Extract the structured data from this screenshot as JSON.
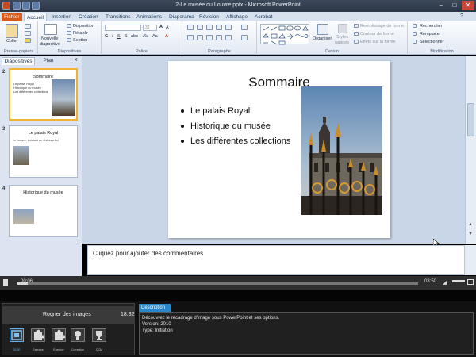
{
  "window": {
    "title": "2-Le musée du Louvre.pptx - Microsoft PowerPoint"
  },
  "ribbon": {
    "tabs": [
      "Fichier",
      "Accueil",
      "Insertion",
      "Création",
      "Transitions",
      "Animations",
      "Diaporama",
      "Révision",
      "Affichage",
      "Acrobat"
    ],
    "clipboard": {
      "paste": "Coller",
      "label": "Presse-papiers"
    },
    "slides": {
      "new_slide_1": "Nouvelle",
      "new_slide_2": "diapositive",
      "layout": "Disposition",
      "reset": "Rétablir",
      "section": "Section",
      "label": "Diapositives"
    },
    "font": {
      "label": "Police",
      "size": "32"
    },
    "paragraph": {
      "label": "Paragraphe"
    },
    "drawing": {
      "arrange": "Organiser",
      "quick_styles_1": "Styles",
      "quick_styles_2": "rapides",
      "fill": "Remplissage de forme",
      "outline": "Contour de forme",
      "effects": "Effets sur la forme",
      "label": "Dessin"
    },
    "editing": {
      "find": "Rechercher",
      "replace": "Remplacer",
      "select": "Sélectionner",
      "label": "Modification"
    }
  },
  "left_pane": {
    "tabs": [
      "Diapositives",
      "Plan"
    ],
    "close": "x",
    "slides": [
      {
        "number": "2",
        "title": "Sommaire",
        "bullets": [
          "Le palais Royal",
          "Historique du musée",
          "Les différentes collections"
        ]
      },
      {
        "number": "3",
        "title": "Le palais Royal",
        "bullets": [
          "Le Louvre, existant un château fort"
        ]
      },
      {
        "number": "4",
        "title": "Historique du musée",
        "bullets": []
      }
    ]
  },
  "slide": {
    "title": "Sommaire",
    "bullets": [
      "Le palais Royal",
      "Historique du musée",
      "Les différentes collections"
    ]
  },
  "notes": {
    "placeholder": "Cliquez pour ajouter des commentaires"
  },
  "player": {
    "elapsed": "00:06",
    "duration": "03:50",
    "progress_fraction": 0.026
  },
  "chapter": {
    "title": "Rogner des images",
    "time": "18:32",
    "buttons": [
      {
        "label": "02:30",
        "icon": "film-icon"
      },
      {
        "label": "Exercice",
        "icon": "puzzle-icon"
      },
      {
        "label": "Exercice",
        "icon": "puzzle-icon"
      },
      {
        "label": "Correction",
        "icon": "lightbulb-icon"
      },
      {
        "label": "QCM",
        "icon": "trophy-icon"
      }
    ]
  },
  "description": {
    "tab": "Description",
    "text": "Découvrez le recadrage d'image sous PowerPoint et ses options.",
    "version": "Version: 2010",
    "type": "Type: Initiation"
  },
  "colors": {
    "file_tab": "#d65a1b",
    "selected_thumb": "#f0b233",
    "description_tab": "#2a86c8"
  }
}
